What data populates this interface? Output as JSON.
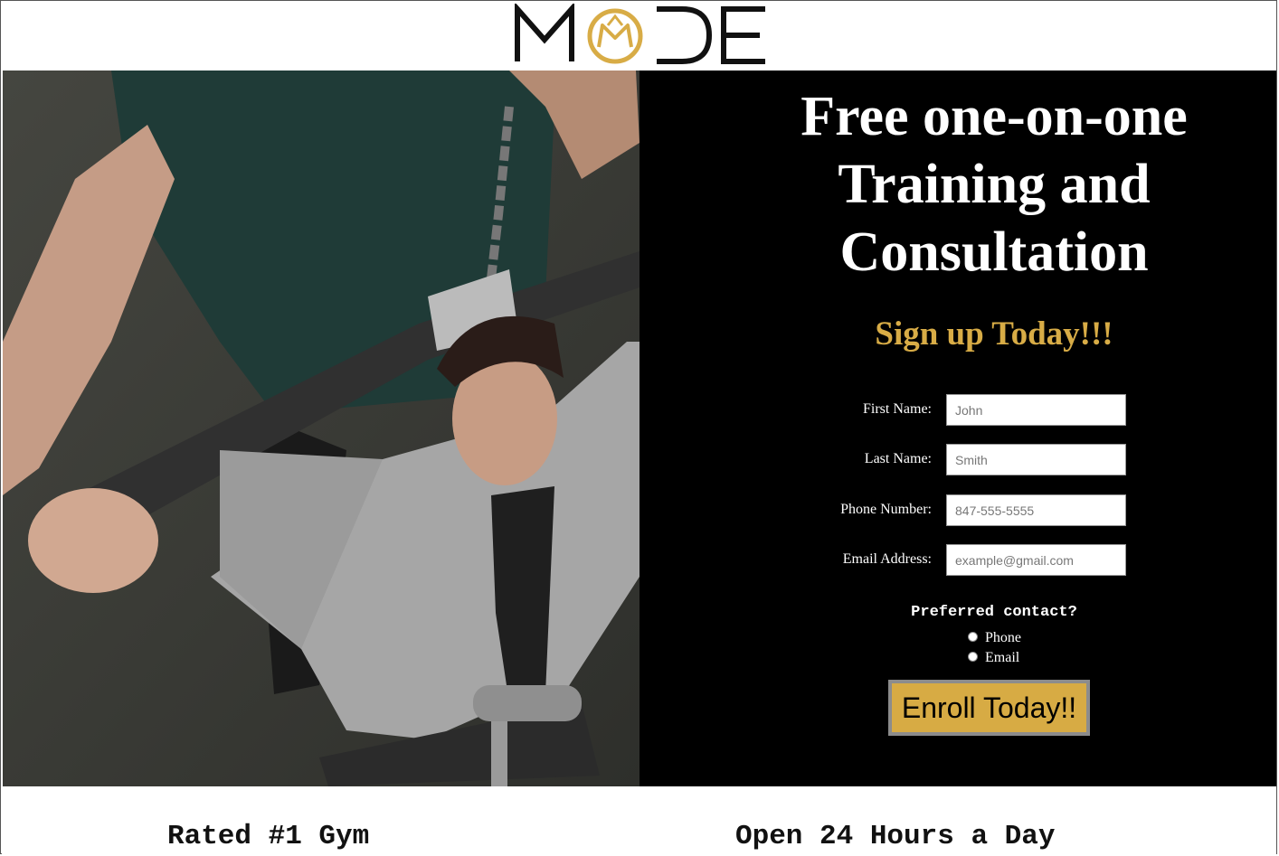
{
  "brand": {
    "logo_text": "MODE",
    "colors": {
      "gold": "#d8ac46",
      "dark": "#111111",
      "panel": "#000000"
    }
  },
  "hero": {
    "title": "Free one-on-one Training and Consultation",
    "subtitle": "Sign up Today!!!"
  },
  "form": {
    "first_name": {
      "label": "First Name:",
      "placeholder": "John"
    },
    "last_name": {
      "label": "Last Name:",
      "placeholder": "Smith"
    },
    "phone": {
      "label": "Phone Number:",
      "placeholder": "847-555-5555"
    },
    "email": {
      "label": "Email Address:",
      "placeholder": "example@gmail.com"
    },
    "contact_label": "Preferred contact?",
    "contact_options": [
      "Phone",
      "Email"
    ],
    "submit_label": "Enroll Today!!"
  },
  "features": [
    "Rated #1 Gym",
    "Open 24 Hours a Day"
  ]
}
